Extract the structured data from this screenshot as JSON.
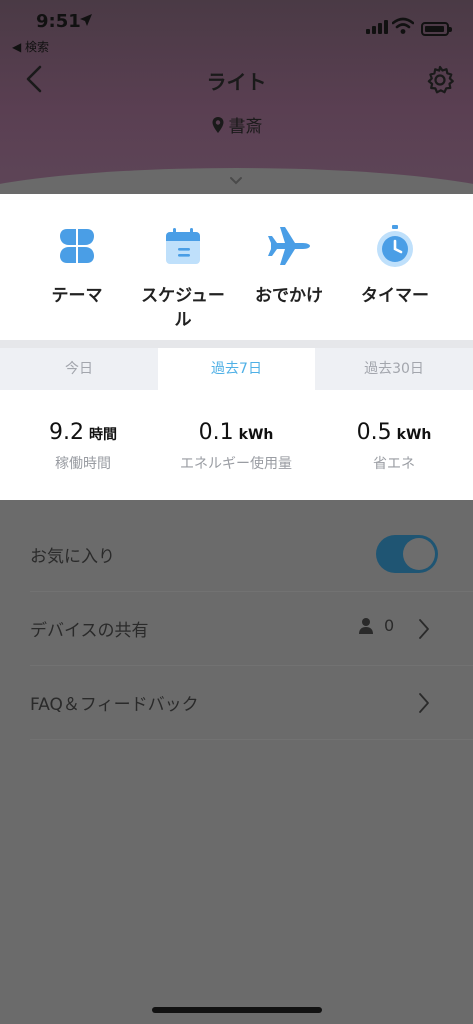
{
  "status_bar": {
    "time": "9:51",
    "back_app": "◀ 検索"
  },
  "nav": {
    "title": "ライト",
    "room": "書斎"
  },
  "features": [
    {
      "label": "テーマ",
      "icon": "theme-icon"
    },
    {
      "label": "スケジュー\nル",
      "icon": "calendar-icon"
    },
    {
      "label": "おでかけ",
      "icon": "airplane-icon"
    },
    {
      "label": "タイマー",
      "icon": "timer-icon"
    }
  ],
  "tabs": [
    "今日",
    "過去7日",
    "過去30日"
  ],
  "stats": [
    {
      "value": "9.2",
      "unit": "時間",
      "label": "稼働時間"
    },
    {
      "value": "0.1",
      "unit": "kWh",
      "label": "エネルギー使用量"
    },
    {
      "value": "0.5",
      "unit": "kWh",
      "label": "省エネ"
    }
  ],
  "settings": {
    "favorite_label": "お気に入り",
    "favorite_on": true,
    "share_label": "デバイスの共有",
    "share_count": "0",
    "faq_label": "FAQ＆フィードバック"
  },
  "colors": {
    "accent": "#4fb0e6",
    "icon_blue": "#4a9ee6",
    "icon_light": "#bfe0fb"
  }
}
